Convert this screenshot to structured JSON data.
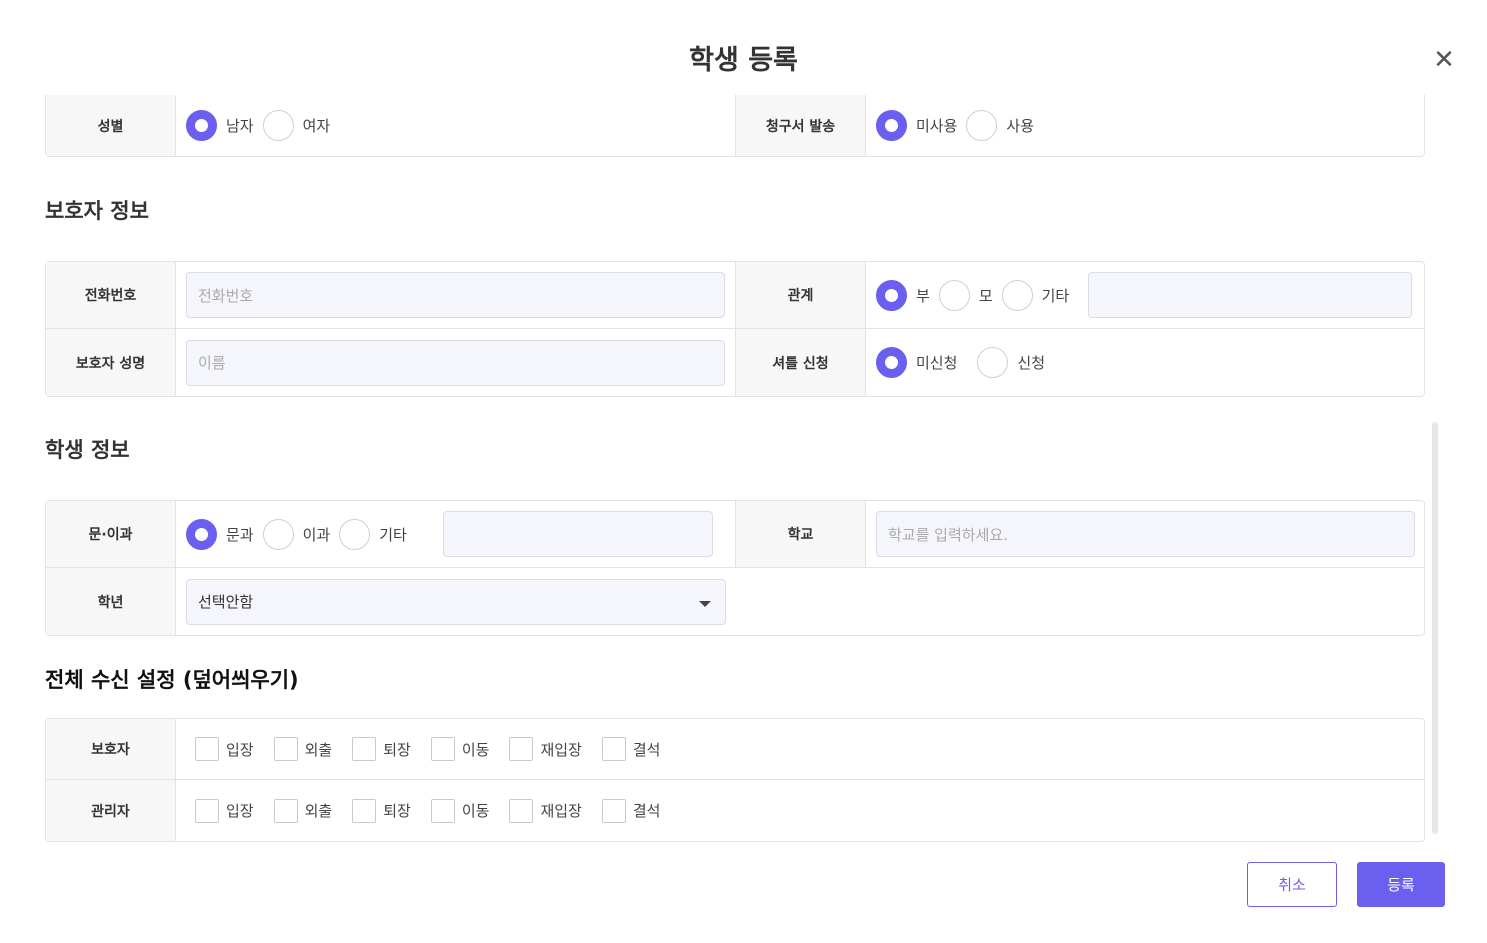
{
  "modal": {
    "title": "학생 등록",
    "close_icon": "✕"
  },
  "top_row": {
    "gender": {
      "label": "성별",
      "options": [
        "남자",
        "여자"
      ],
      "selected": "남자"
    },
    "invoice": {
      "label": "청구서 발송",
      "options": [
        "미사용",
        "사용"
      ],
      "selected": "미사용"
    }
  },
  "guardian_section": {
    "title": "보호자 정보",
    "phone": {
      "label": "전화번호",
      "placeholder": "전화번호"
    },
    "relation": {
      "label": "관계",
      "options": [
        "부",
        "모",
        "기타"
      ],
      "selected": "부"
    },
    "name": {
      "label": "보호자 성명",
      "placeholder": "이름"
    },
    "shuttle": {
      "label": "셔틀 신청",
      "options": [
        "미신청",
        "신청"
      ],
      "selected": "미신청"
    }
  },
  "student_section": {
    "title": "학생 정보",
    "track": {
      "label": "문·이과",
      "options": [
        "문과",
        "이과",
        "기타"
      ],
      "selected": "문과"
    },
    "school": {
      "label": "학교",
      "placeholder": "학교를 입력하세요."
    },
    "grade": {
      "label": "학년",
      "value": "선택안함"
    }
  },
  "notify_section": {
    "title": "전체 수신 설정 (덮어씌우기)",
    "rows": [
      {
        "label": "보호자",
        "options": [
          "입장",
          "외출",
          "퇴장",
          "이동",
          "재입장",
          "결석"
        ]
      },
      {
        "label": "관리자",
        "options": [
          "입장",
          "외출",
          "퇴장",
          "이동",
          "재입장",
          "결석"
        ]
      }
    ]
  },
  "buttons": {
    "cancel": "취소",
    "submit": "등록"
  },
  "colors": {
    "accent": "#6b5ff0"
  }
}
